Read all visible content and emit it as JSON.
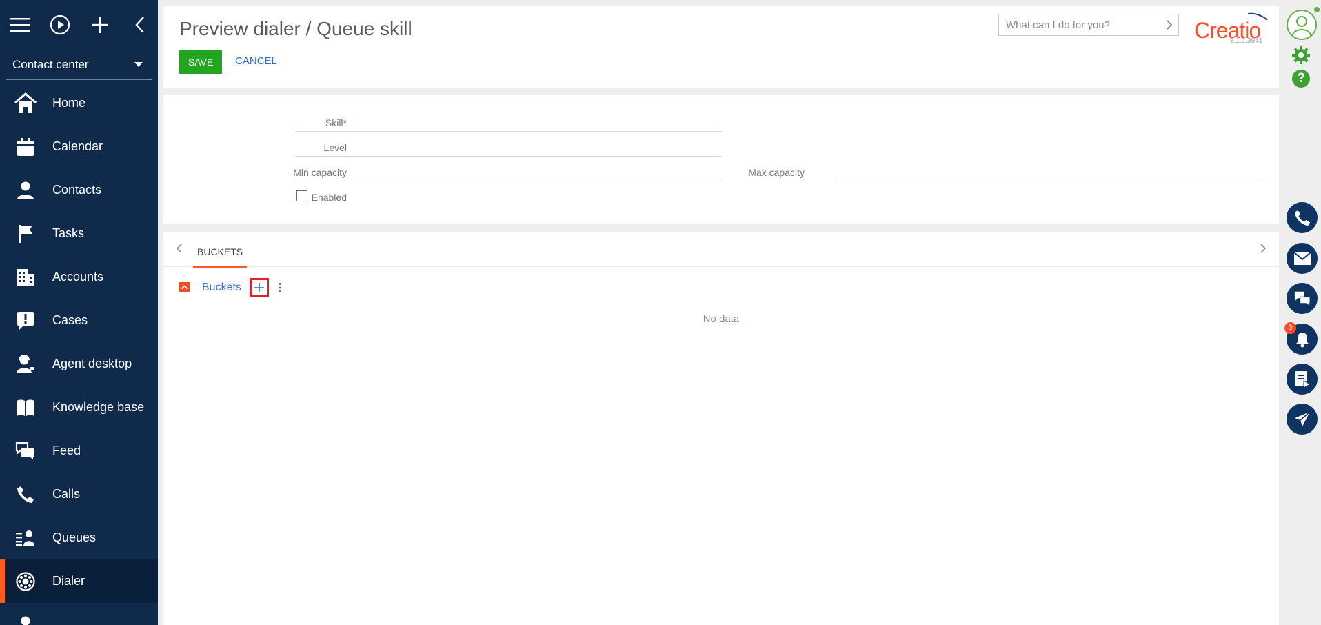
{
  "sidebar": {
    "workspace": "Contact center",
    "items": [
      {
        "label": "Home",
        "icon": "home-icon"
      },
      {
        "label": "Calendar",
        "icon": "calendar-icon"
      },
      {
        "label": "Contacts",
        "icon": "contact-icon"
      },
      {
        "label": "Tasks",
        "icon": "flag-icon"
      },
      {
        "label": "Accounts",
        "icon": "building-icon"
      },
      {
        "label": "Cases",
        "icon": "case-icon"
      },
      {
        "label": "Agent desktop",
        "icon": "agent-icon"
      },
      {
        "label": "Knowledge base",
        "icon": "book-icon"
      },
      {
        "label": "Feed",
        "icon": "chat-icon"
      },
      {
        "label": "Calls",
        "icon": "phone-icon"
      },
      {
        "label": "Queues",
        "icon": "queue-icon"
      },
      {
        "label": "Dialer",
        "icon": "dialer-icon",
        "active": true
      }
    ]
  },
  "header": {
    "title": "Preview dialer / Queue skill",
    "save_label": "SAVE",
    "cancel_label": "CANCEL",
    "search_placeholder": "What can I do for you?",
    "logo": "Creatio",
    "version": "8.1.2.3941"
  },
  "form": {
    "skill_label": "Skill",
    "skill_required_mark": "*",
    "level_label": "Level",
    "min_capacity_label": "Min capacity",
    "max_capacity_label": "Max capacity",
    "enabled_label": "Enabled",
    "enabled_checked": false
  },
  "tabs": {
    "active": "BUCKETS",
    "detail_title": "Buckets",
    "no_data": "No data"
  },
  "rail": {
    "notification_count": "3"
  },
  "colors": {
    "sidebar": "#0f2a4b",
    "accent": "#ff5a1f",
    "save": "#23a51f",
    "link": "#2d6fc9",
    "cti": "#0f3462"
  }
}
